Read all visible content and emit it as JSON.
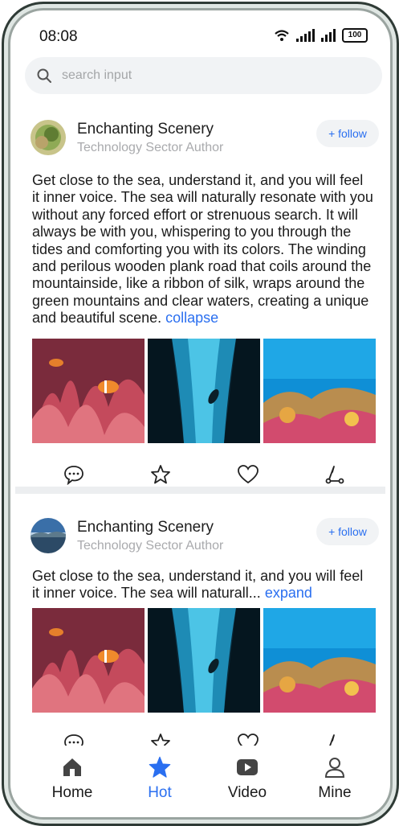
{
  "status_bar": {
    "time": "08:08",
    "battery": "100"
  },
  "search": {
    "placeholder": "search input"
  },
  "posts": [
    {
      "author": "Enchanting Scenery",
      "role": "Technology Sector Author",
      "follow_label": "+ follow",
      "text": "Get close to the sea, understand it, and you will feel it inner voice. The sea will naturally resonate with you without any forced effort or strenuous search. It will always be with you, whispering to you through the tides and comforting you with its colors. The winding and perilous wooden plank road that coils around the mountainside, like a ribbon of silk, wraps around the green mountains and clear waters, creating a unique and beautiful scene.",
      "toggle_label": "collapse",
      "images": [
        "clownfish-anemone-image",
        "underwater-cave-diver-image",
        "coral-reef-image"
      ]
    },
    {
      "author": "Enchanting Scenery",
      "role": "Technology Sector Author",
      "follow_label": "+ follow",
      "text": "Get close to the sea, understand it, and you will feel it inner voice. The sea will naturall...",
      "toggle_label": "expand",
      "images": [
        "clownfish-anemone-image",
        "underwater-cave-diver-image",
        "coral-reef-image"
      ]
    }
  ],
  "actions": [
    "comment-icon",
    "star-icon",
    "heart-icon",
    "share-icon"
  ],
  "tabs": [
    {
      "label": "Home",
      "icon": "home-icon"
    },
    {
      "label": "Hot",
      "icon": "star-icon",
      "active": true
    },
    {
      "label": "Video",
      "icon": "video-icon"
    },
    {
      "label": "Mine",
      "icon": "person-icon"
    }
  ],
  "colors": {
    "accent": "#2a6ff0",
    "text": "#1b1b1b",
    "muted": "#a9aaad"
  }
}
